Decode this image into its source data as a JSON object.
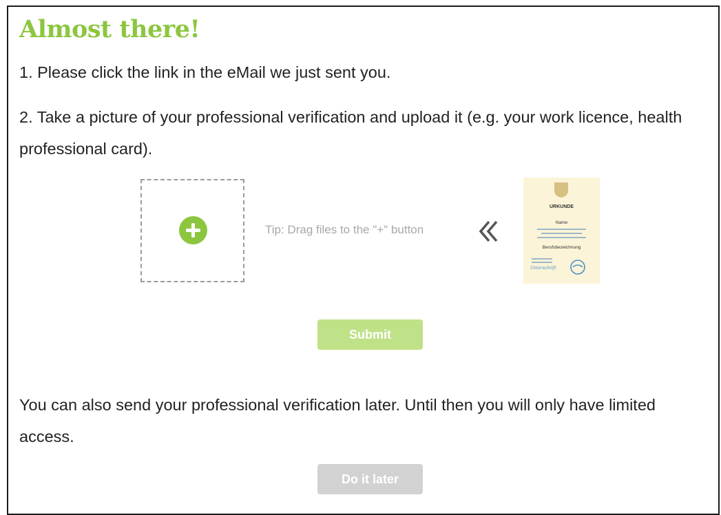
{
  "title": "Almost there!",
  "steps": [
    "1. Please click the link in the eMail we just sent you.",
    "2. Take a picture of your professional verification and upload it (e.g. your work licence, health professional card)."
  ],
  "upload": {
    "tip": "Tip: Drag files to the \"+\" button",
    "plus_icon": "plus-circle-icon",
    "arrow_icon": "double-chevron-left-icon"
  },
  "certificate": {
    "heading": "URKUNDE",
    "name_label": "Name",
    "job_label": "Berufsbezeichnung",
    "signature": "Unterschrift"
  },
  "submit_label": "Submit",
  "later_text": "You can also send your professional verification later. Until then you will only have limited access.",
  "later_label": "Do it later",
  "colors": {
    "accent": "#8cc63f",
    "submit_bg": "#bfe188",
    "later_bg": "#d2d2d2",
    "text": "#222222",
    "tip": "#a8a8a8"
  }
}
